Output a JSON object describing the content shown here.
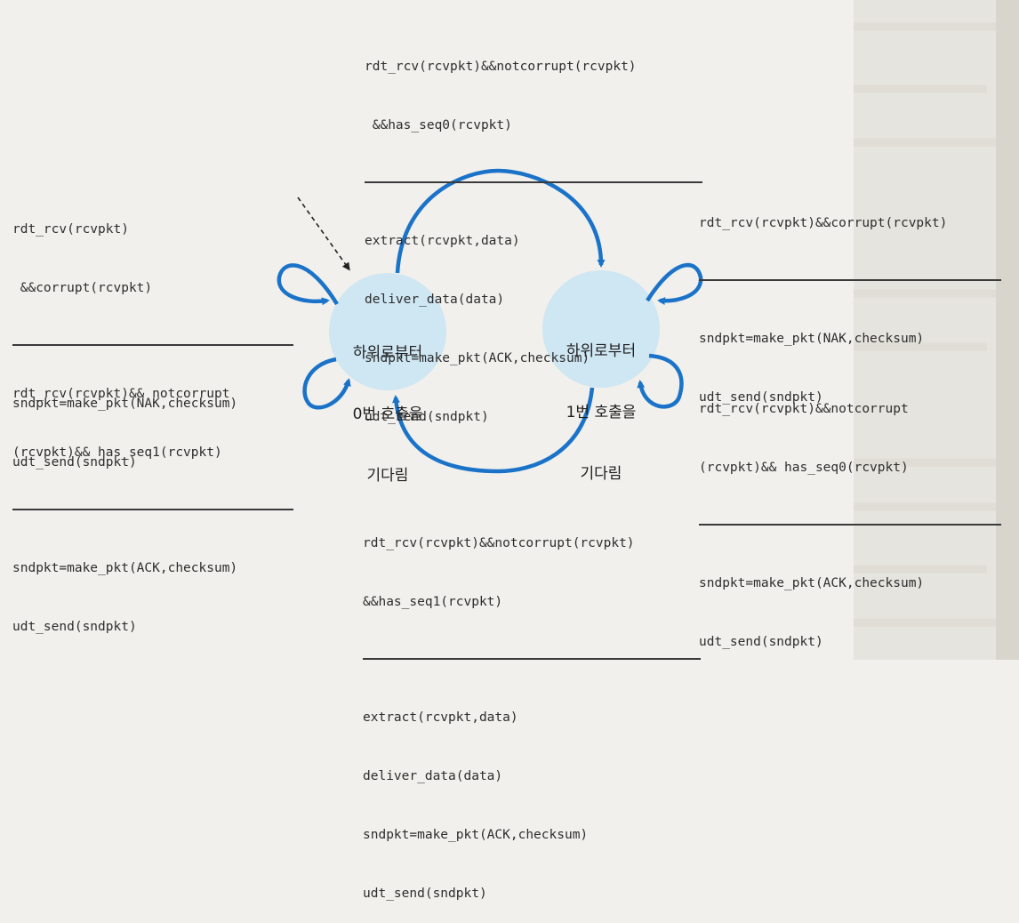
{
  "colors": {
    "state_fill": "#cfe6f3",
    "arrow": "#1a73c9",
    "rule": "#3a3a3a",
    "text": "#2d2d2d"
  },
  "states": [
    {
      "id": "wait-0",
      "lines": [
        "하위로부터",
        "0번 호출을",
        "기다림"
      ]
    },
    {
      "id": "wait-1",
      "lines": [
        "하위로부터",
        "1번 호출을",
        "기다림"
      ]
    }
  ],
  "transitions": {
    "top_0_to_1": {
      "event": [
        "rdt_rcv(rcvpkt)&&notcorrupt(rcvpkt)",
        " &&has_seq0(rcvpkt)"
      ],
      "actions": [
        "extract(rcvpkt,data)",
        "deliver_data(data)",
        "sndpkt=make_pkt(ACK,checksum)",
        "udt_send(sndpkt)"
      ]
    },
    "bottom_1_to_0": {
      "event": [
        "rdt_rcv(rcvpkt)&&notcorrupt(rcvpkt)",
        "&&has_seq1(rcvpkt)"
      ],
      "actions": [
        "extract(rcvpkt,data)",
        "deliver_data(data)",
        "sndpkt=make_pkt(ACK,checksum)",
        "udt_send(sndpkt)"
      ]
    },
    "left_corrupt": {
      "event": [
        "rdt_rcv(rcvpkt)",
        " &&corrupt(rcvpkt)"
      ],
      "actions": [
        "sndpkt=make_pkt(NAK,checksum)",
        "udt_send(sndpkt)"
      ]
    },
    "left_seq1": {
      "event": [
        "rdt_rcv(rcvpkt)&& notcorrupt",
        "(rcvpkt)&& has_seq1(rcvpkt)"
      ],
      "actions": [
        "sndpkt=make_pkt(ACK,checksum)",
        "udt_send(sndpkt)"
      ]
    },
    "right_corrupt": {
      "event": [
        "rdt_rcv(rcvpkt)&&corrupt(rcvpkt)"
      ],
      "actions": [
        "sndpkt=make_pkt(NAK,checksum)",
        "udt_send(sndpkt)"
      ]
    },
    "right_seq0": {
      "event": [
        "rdt_rcv(rcvpkt)&&notcorrupt",
        "(rcvpkt)&& has_seq0(rcvpkt)"
      ],
      "actions": [
        "sndpkt=make_pkt(ACK,checksum)",
        "udt_send(sndpkt)"
      ]
    }
  }
}
